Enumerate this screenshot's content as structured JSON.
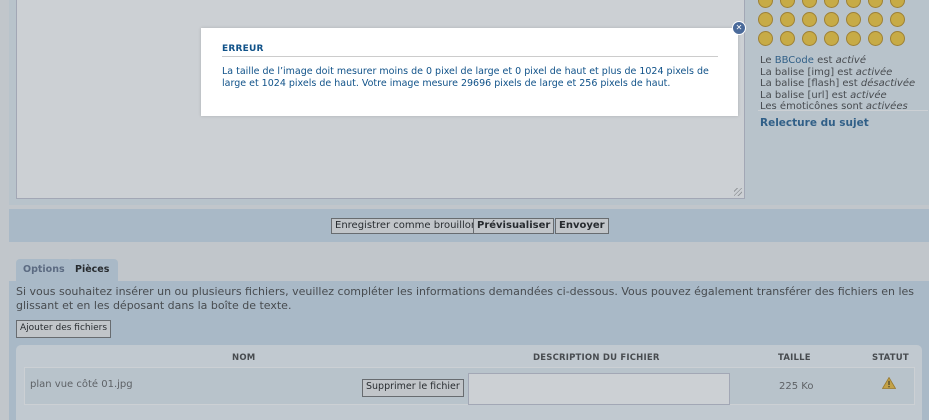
{
  "sidebar": {
    "smilies_rows": [
      [
        "😁",
        "😄",
        "😮",
        "😕",
        "😎",
        "😠",
        "😐"
      ],
      [
        "😊",
        "😯",
        "😜",
        "😂",
        "😺",
        "😈",
        "😊"
      ],
      [
        "❗",
        "❓",
        "💡",
        "➡",
        "😛",
        "🙂",
        "😎"
      ]
    ],
    "bbcode_prefix": "Le",
    "bbcode_link": "BBCode",
    "bbcode_mid": "est",
    "bbcode_state": "activé",
    "img_prefix": "La balise [img] est",
    "img_state": "activée",
    "flash_prefix": "La balise [flash] est",
    "flash_state": "désactivée",
    "url_prefix": "La balise [url] est",
    "url_state": "activée",
    "smilies_prefix": "Les émoticônes sont",
    "smilies_state": "activées",
    "review_link": "Relecture du sujet"
  },
  "buttons": {
    "save_draft": "Enregistrer comme brouillon",
    "preview": "Prévisualiser",
    "submit": "Envoyer"
  },
  "tabs": {
    "options": "Options",
    "attachments": "Pièces jointes"
  },
  "attachments": {
    "description": "Si vous souhaitez insérer un ou plusieurs fichiers, veuillez compléter les informations demandées ci-dessous. Vous pouvez également transférer des fichiers en les glissant et en les déposant dans la boîte de texte.",
    "add_files": "Ajouter des fichiers",
    "columns": {
      "name": "NOM",
      "description": "DESCRIPTION DU FICHIER",
      "size": "TAILLE",
      "status": "STATUT"
    },
    "file": {
      "name": "plan vue côté 01.jpg",
      "delete_label": "Supprimer le fichier",
      "description_value": "",
      "size": "225 Ko",
      "status_icon": "warning-icon"
    }
  },
  "modal": {
    "title": "ERREUR",
    "message": "La taille de l’image doit mesurer moins de 0 pixel de large et 0 pixel de haut et plus de 1024 pixels de large et 1024 pixels de haut. Votre image mesure 29696 pixels de large et 256 pixels de haut.",
    "close_icon": "close-icon"
  },
  "colors": {
    "accent": "#105289",
    "panel": "#cadceb",
    "warning": "#e8a317"
  }
}
